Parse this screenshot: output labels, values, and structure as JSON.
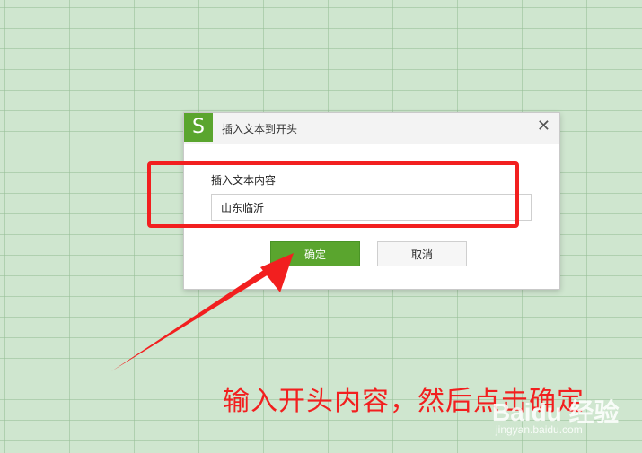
{
  "dialog": {
    "app_icon": "S",
    "title": "插入文本到开头",
    "close_glyph": "✕",
    "field_label": "插入文本内容",
    "field_value": "山东临沂",
    "ok_label": "确定",
    "cancel_label": "取消"
  },
  "annotation": {
    "text": "输入开头内容，然后点击确定",
    "color": "#f21f1f"
  },
  "watermark": {
    "brand": "Baidu 经验",
    "url": "jingyan.baidu.com"
  },
  "colors": {
    "accent": "#5aa52e",
    "sheet_bg": "#cfe6cf"
  }
}
